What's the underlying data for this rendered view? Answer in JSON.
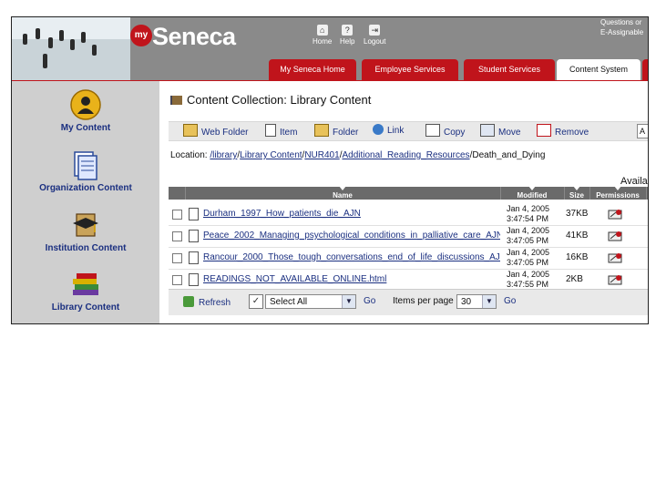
{
  "header": {
    "logo_my": "my",
    "logo_name": "Seneca",
    "top_nav": [
      {
        "label": "Home",
        "icon": "home-icon"
      },
      {
        "label": "Help",
        "icon": "help-icon"
      },
      {
        "label": "Logout",
        "icon": "logout-icon"
      }
    ],
    "questions_line1": "Questions or",
    "questions_line2": "E-Assignable",
    "tabs": [
      {
        "label": "My Seneca Home",
        "active": false
      },
      {
        "label": "Employee Services",
        "active": false
      },
      {
        "label": "Student Services",
        "active": false
      },
      {
        "label": "Content System",
        "active": true
      }
    ]
  },
  "sidebar": {
    "items": [
      {
        "label": "My Content",
        "icon": "person-icon"
      },
      {
        "label": "Organization Content",
        "icon": "documents-icon"
      },
      {
        "label": "Institution Content",
        "icon": "graduation-cap-icon"
      },
      {
        "label": "Library Content",
        "icon": "books-icon"
      }
    ]
  },
  "main": {
    "title": "Content Collection: Library Content",
    "toolbar": [
      {
        "label": "Web Folder",
        "icon": "web-folder-icon"
      },
      {
        "label": "Item",
        "icon": "item-icon"
      },
      {
        "label": "Folder",
        "icon": "folder-icon"
      },
      {
        "label": "Link",
        "icon": "globe-link-icon"
      },
      {
        "label": "Copy",
        "icon": "copy-icon"
      },
      {
        "label": "Move",
        "icon": "move-icon"
      },
      {
        "label": "Remove",
        "icon": "remove-icon"
      }
    ],
    "search_value": "A",
    "location_label": "Location:",
    "location_parts": [
      "/library",
      "Library Content",
      "NUR401",
      "Additional_Reading_Resources",
      "Death_and_Dying"
    ],
    "available_label": "Availa",
    "columns": [
      "Name",
      "Modified",
      "Size",
      "Permissions"
    ],
    "rows": [
      {
        "name": "Durham_1997_How_patients_die_AJN",
        "modified_date": "Jan 4, 2005",
        "modified_time": "3:47:54 PM",
        "size": "37KB"
      },
      {
        "name": "Peace_2002_Managing_psychological_conditions_in_palliative_care_AJN",
        "modified_date": "Jan 4, 2005",
        "modified_time": "3:47:05 PM",
        "size": "41KB"
      },
      {
        "name": "Rancour_2000_Those_tough_conversations_end_of_life_discussions_AJN",
        "modified_date": "Jan 4, 2005",
        "modified_time": "3:47:05 PM",
        "size": "16KB"
      },
      {
        "name": "READINGS_NOT_AVAILABLE_ONLINE.html",
        "modified_date": "Jan 4, 2005",
        "modified_time": "3:47:55 PM",
        "size": "2KB"
      }
    ],
    "bottom": {
      "refresh_label": "Refresh",
      "select_value": "Select All",
      "go_label": "Go",
      "items_per_page_label": "Items per page",
      "items_per_page_value": "30",
      "go2_label": "Go"
    }
  },
  "colors": {
    "brand_red": "#c0141b",
    "header_gray": "#8a8a8a",
    "sidebar_gray": "#cfcfcf",
    "link_blue": "#1a2f80"
  }
}
